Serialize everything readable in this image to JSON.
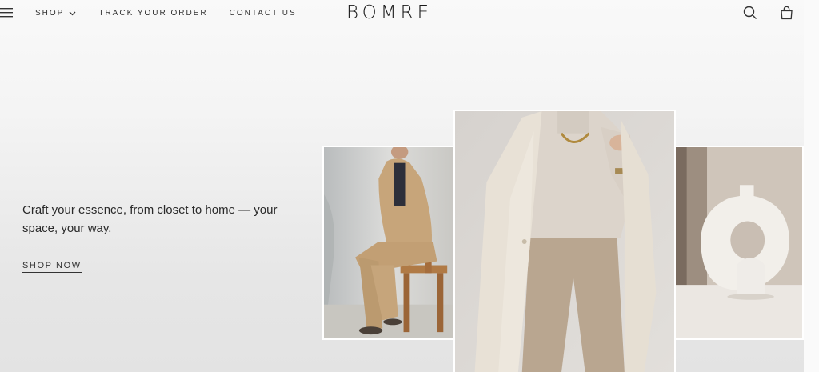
{
  "header": {
    "nav": [
      {
        "label": "SHOP"
      },
      {
        "label": "TRACK YOUR ORDER"
      },
      {
        "label": "CONTACT US"
      }
    ],
    "logo": "BOMRE"
  },
  "hero": {
    "tagline": "Craft your essence, from closet to home — your space, your way.",
    "cta": "SHOP NOW"
  },
  "icons": {
    "menu": "menu-icon",
    "chevron": "chevron-down-icon",
    "search": "search-icon",
    "bag": "shopping-bag-icon"
  }
}
